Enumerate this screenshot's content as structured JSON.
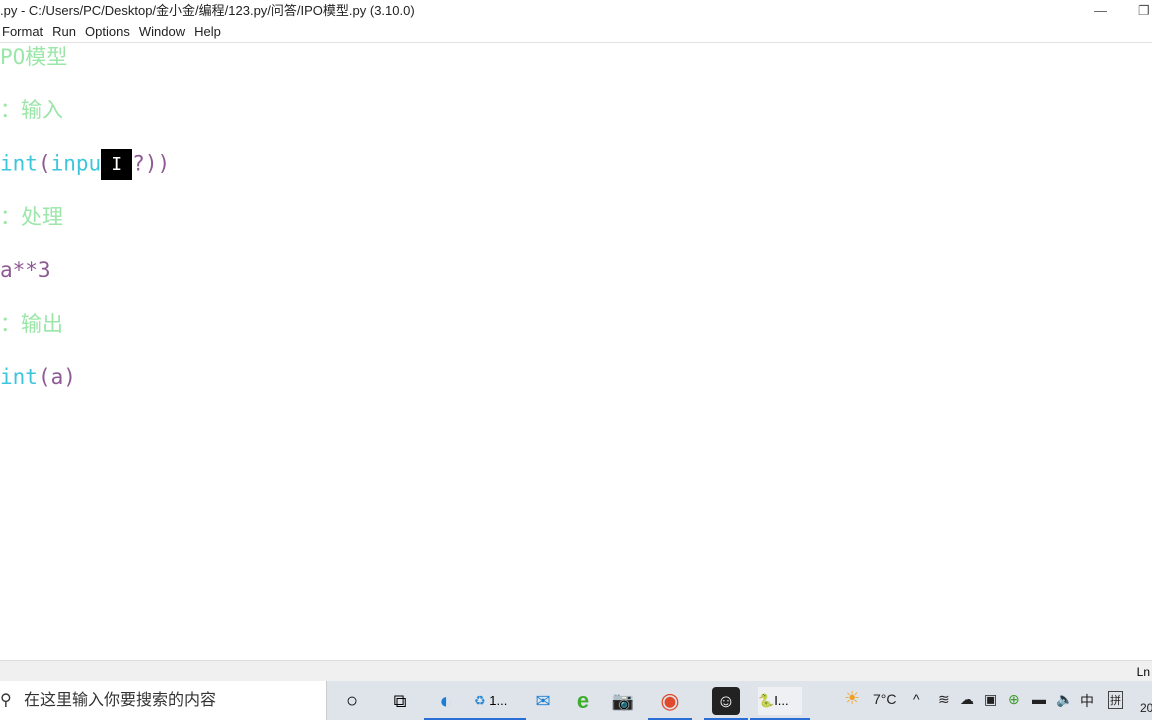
{
  "window": {
    "title": ".py - C:/Users/PC/Desktop/金小金/编程/123.py/问答/IPO模型.py (3.10.0)",
    "minimize": "—",
    "restore": "❐"
  },
  "menu": [
    "Format",
    "Run",
    "Options",
    "Window",
    "Help"
  ],
  "code": {
    "line1": "PO模型",
    "line2": "：输入",
    "line3_builtin": "int",
    "line3_paren": "(",
    "line3_builtin2": "inpu",
    "line3_cursor": "I",
    "line3_rest": "?))",
    "line4": "：处理",
    "line5": "a**3",
    "line6": "：输出",
    "line7_builtin": "int",
    "line7_rest": "(a)"
  },
  "colors": {
    "comment": "#9be6a8",
    "builtin": "#3cc6dc",
    "text": "#8e5a94"
  },
  "status": {
    "position": "Ln"
  },
  "taskbar": {
    "search_placeholder": "在这里输入你要搜索的内容",
    "apps": [
      {
        "icon": "cortana-icon"
      },
      {
        "icon": "task-view-icon"
      },
      {
        "icon": "edge-icon"
      },
      {
        "icon": "recycle-app-icon",
        "label": "1..."
      },
      {
        "icon": "mail-icon"
      },
      {
        "icon": "ie-icon"
      },
      {
        "icon": "camera-icon"
      },
      {
        "icon": "chrome-icon"
      },
      {
        "icon": "bot-app-icon"
      },
      {
        "icon": "python-idle-icon",
        "label": "I..."
      }
    ],
    "weather": "7°C",
    "ime": "中",
    "ime2": "拼",
    "clock": "20"
  }
}
